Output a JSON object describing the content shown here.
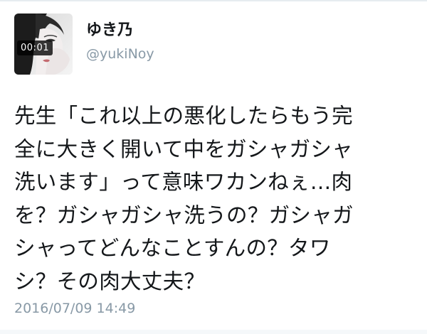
{
  "user": {
    "display_name": "ゆき乃",
    "handle": "@yukiNoy",
    "avatar_video_time": "00:01"
  },
  "tweet": {
    "lines": [
      "先生「これ以上の悪化したらもう完",
      "全に大きく開いて中をガシャガシャ",
      "洗います」って意味ワカンねぇ…肉",
      "を？ガシャガシャ洗うの？ガシャガ",
      "シャってどんなことすんの？タワ",
      "シ？その肉大丈夫？"
    ],
    "timestamp": "2016/07/09 14:49"
  },
  "icons": {
    "avatar": "profile-photo-video-thumbnail"
  }
}
